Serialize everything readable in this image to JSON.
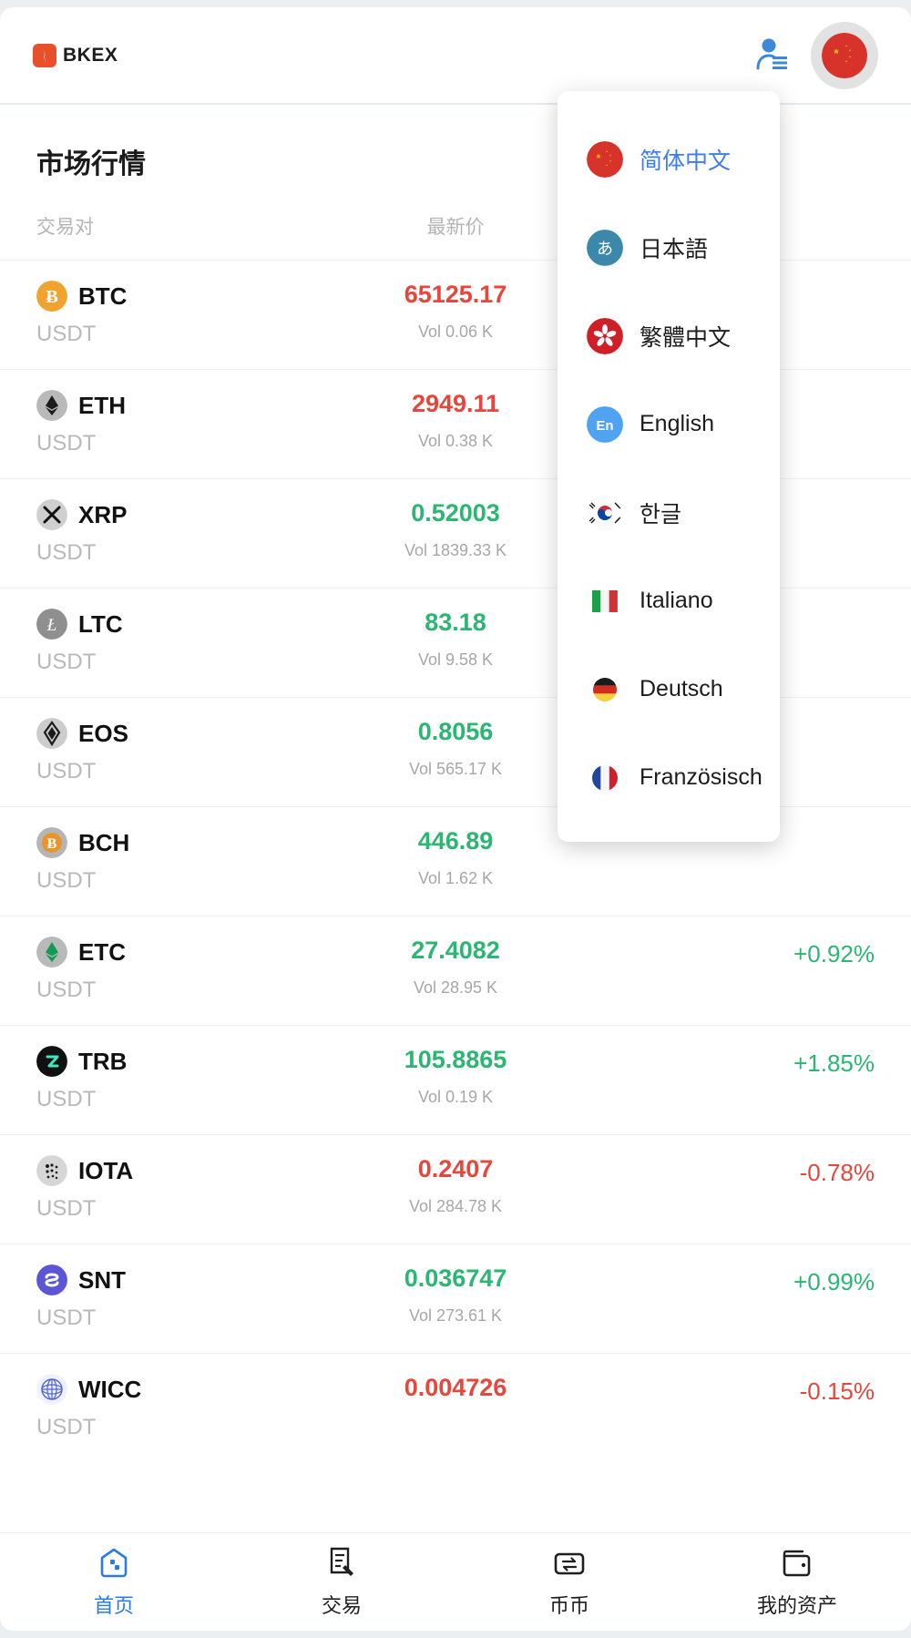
{
  "header": {
    "logo_text": "BKEX",
    "account_icon": "person-lines-icon",
    "language_button_icon": "flag-cn-icon",
    "accent_blue": "#3d7cf4",
    "logo_red": "#e8502c"
  },
  "market": {
    "title": "市场行情",
    "columns": {
      "pair": "交易对",
      "price": "最新价",
      "change": ""
    },
    "quote": "USDT",
    "up_color": "#2bb673",
    "down_color": "#e8453c",
    "rows": [
      {
        "symbol": "BTC",
        "icon": "btc-icon",
        "quote": "USDT",
        "price": "65125.17",
        "volume": "Vol 0.06 K",
        "change": "",
        "dir": "down"
      },
      {
        "symbol": "ETH",
        "icon": "eth-icon",
        "quote": "USDT",
        "price": "2949.11",
        "volume": "Vol 0.38 K",
        "change": "",
        "dir": "down"
      },
      {
        "symbol": "XRP",
        "icon": "xrp-icon",
        "quote": "USDT",
        "price": "0.52003",
        "volume": "Vol 1839.33 K",
        "change": "",
        "dir": "up"
      },
      {
        "symbol": "LTC",
        "icon": "ltc-icon",
        "quote": "USDT",
        "price": "83.18",
        "volume": "Vol 9.58 K",
        "change": "",
        "dir": "up"
      },
      {
        "symbol": "EOS",
        "icon": "eos-icon",
        "quote": "USDT",
        "price": "0.8056",
        "volume": "Vol 565.17 K",
        "change": "",
        "dir": "up"
      },
      {
        "symbol": "BCH",
        "icon": "bch-icon",
        "quote": "USDT",
        "price": "446.89",
        "volume": "Vol 1.62 K",
        "change": "",
        "dir": "up"
      },
      {
        "symbol": "ETC",
        "icon": "etc-icon",
        "quote": "USDT",
        "price": "27.4082",
        "volume": "Vol 28.95 K",
        "change": "+0.92%",
        "dir": "up"
      },
      {
        "symbol": "TRB",
        "icon": "trb-icon",
        "quote": "USDT",
        "price": "105.8865",
        "volume": "Vol 0.19 K",
        "change": "+1.85%",
        "dir": "up"
      },
      {
        "symbol": "IOTA",
        "icon": "iota-icon",
        "quote": "USDT",
        "price": "0.2407",
        "volume": "Vol 284.78 K",
        "change": "-0.78%",
        "dir": "down"
      },
      {
        "symbol": "SNT",
        "icon": "snt-icon",
        "quote": "USDT",
        "price": "0.036747",
        "volume": "Vol 273.61 K",
        "change": "+0.99%",
        "dir": "up"
      },
      {
        "symbol": "WICC",
        "icon": "wicc-icon",
        "quote": "USDT",
        "price": "0.004726",
        "volume": "",
        "change": "-0.15%",
        "dir": "down"
      }
    ]
  },
  "language_menu": {
    "items": [
      {
        "label": "简体中文",
        "flag": "flag-cn-icon",
        "active": true
      },
      {
        "label": "日本語",
        "flag": "flag-jp-kana-icon",
        "active": false
      },
      {
        "label": "繁體中文",
        "flag": "flag-hk-icon",
        "active": false
      },
      {
        "label": "English",
        "flag": "flag-en-icon",
        "active": false
      },
      {
        "label": "한글",
        "flag": "flag-kr-icon",
        "active": false
      },
      {
        "label": "Italiano",
        "flag": "flag-it-icon",
        "active": false
      },
      {
        "label": "Deutsch",
        "flag": "flag-de-icon",
        "active": false
      },
      {
        "label": "Französisch",
        "flag": "flag-fr-icon",
        "active": false
      }
    ]
  },
  "bottom_nav": {
    "items": [
      {
        "label": "首页",
        "icon": "home-icon",
        "active": true
      },
      {
        "label": "交易",
        "icon": "trade-doc-icon",
        "active": false
      },
      {
        "label": "币币",
        "icon": "coin-exchange-icon",
        "active": false
      },
      {
        "label": "我的资产",
        "icon": "wallet-icon",
        "active": false
      }
    ]
  }
}
